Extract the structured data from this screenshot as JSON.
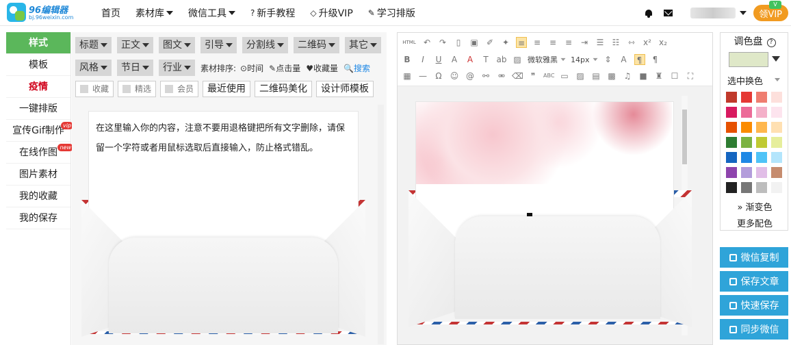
{
  "logo": {
    "name": "96编辑器",
    "url": "bj.96weixin.com"
  },
  "nav": [
    {
      "label": "首页",
      "dropdown": false,
      "icon": ""
    },
    {
      "label": "素材库",
      "dropdown": true,
      "icon": ""
    },
    {
      "label": "微信工具",
      "dropdown": true,
      "icon": ""
    },
    {
      "label": "新手教程",
      "dropdown": false,
      "icon": "?"
    },
    {
      "label": "升级VIP",
      "dropdown": false,
      "icon": "◇"
    },
    {
      "label": "学习排版",
      "dropdown": false,
      "icon": "✎"
    }
  ],
  "header": {
    "vip_button": "领VIP",
    "vip_tag": "V"
  },
  "sidebar": {
    "items": [
      {
        "label": "样式",
        "state": "active",
        "badge": ""
      },
      {
        "label": "模板",
        "state": "",
        "badge": ""
      },
      {
        "label": "疫情",
        "state": "hot",
        "badge": ""
      },
      {
        "label": "一键排版",
        "state": "",
        "badge": ""
      },
      {
        "label": "宣传Gif制作",
        "state": "",
        "badge": "vip"
      },
      {
        "label": "在线作图",
        "state": "",
        "badge": "new"
      },
      {
        "label": "图片素材",
        "state": "",
        "badge": ""
      },
      {
        "label": "我的收藏",
        "state": "",
        "badge": ""
      },
      {
        "label": "我的保存",
        "state": "",
        "badge": ""
      }
    ]
  },
  "filters": {
    "row1": [
      "标题",
      "正文",
      "图文",
      "引导",
      "分割线",
      "二维码",
      "其它"
    ],
    "row2": [
      "风格",
      "节日",
      "行业"
    ],
    "sort_label": "素材排序:",
    "sort": [
      {
        "icon": "⊙",
        "label": "时间"
      },
      {
        "icon": "✎",
        "label": "点击量"
      },
      {
        "icon": "♥",
        "label": "收藏量"
      }
    ],
    "search": "搜索",
    "search_icon": "🔍",
    "checks": [
      "收藏",
      "精选",
      "会员"
    ],
    "buttons": [
      "最近使用",
      "二维码美化",
      "设计师模板"
    ]
  },
  "preview_text": "在这里输入你的内容，注意不要用退格键把所有文字删除，请保留一个字符或者用鼠标选取后直接输入，防止格式错乱。",
  "editor": {
    "html_button": "HTML",
    "font_family": "微软雅黑",
    "font_size": "14px"
  },
  "palette": {
    "title": "调色盘",
    "help": "?",
    "current_color": "#dfe8c8",
    "mode_label": "选中换色",
    "colors": [
      [
        "#c0392b",
        "#e53935",
        "#ef7d70",
        "#fde0dc"
      ],
      [
        "#d81b60",
        "#ec6b98",
        "#f4b0c9",
        "#fde4ee"
      ],
      [
        "#e65100",
        "#fb8c00",
        "#ffb74d",
        "#ffe0b2"
      ],
      [
        "#2e7d32",
        "#7cb342",
        "#c0ca33",
        "#e6ee9c"
      ],
      [
        "#1565c0",
        "#1e88e5",
        "#4fc3f7",
        "#b3e5fc"
      ],
      [
        "#8e44ad",
        "#b39ddb",
        "#e1bee7",
        "#c68c6e"
      ],
      [
        "#222222",
        "#777777",
        "#bdbdbd",
        "#f2f2f2"
      ]
    ],
    "gradient": "渐变色",
    "more": "更多配色"
  },
  "actions": [
    "微信复制",
    "保存文章",
    "快速保存",
    "同步微信"
  ],
  "colors": {
    "accent_green": "#5bb75b",
    "accent_blue": "#2fa4d9",
    "vip_orange": "#f19b21",
    "hot_red": "#d0021b"
  }
}
